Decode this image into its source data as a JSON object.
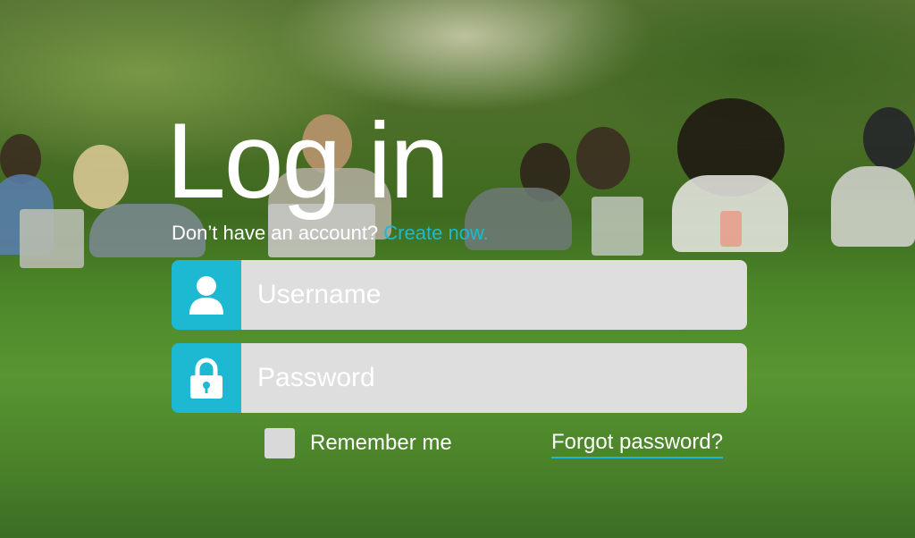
{
  "login": {
    "title": "Log in",
    "no_account_text": "Don’t have an account?",
    "create_link": "Create now.",
    "username_placeholder": "Username",
    "password_placeholder": "Password",
    "remember_label": "Remember me",
    "forgot_link": "Forgot password?"
  },
  "icons": {
    "username": "user-icon",
    "password": "lock-icon"
  },
  "colors": {
    "accent": "#1db8d2",
    "input_bg": "#dedede",
    "text": "#ffffff"
  }
}
